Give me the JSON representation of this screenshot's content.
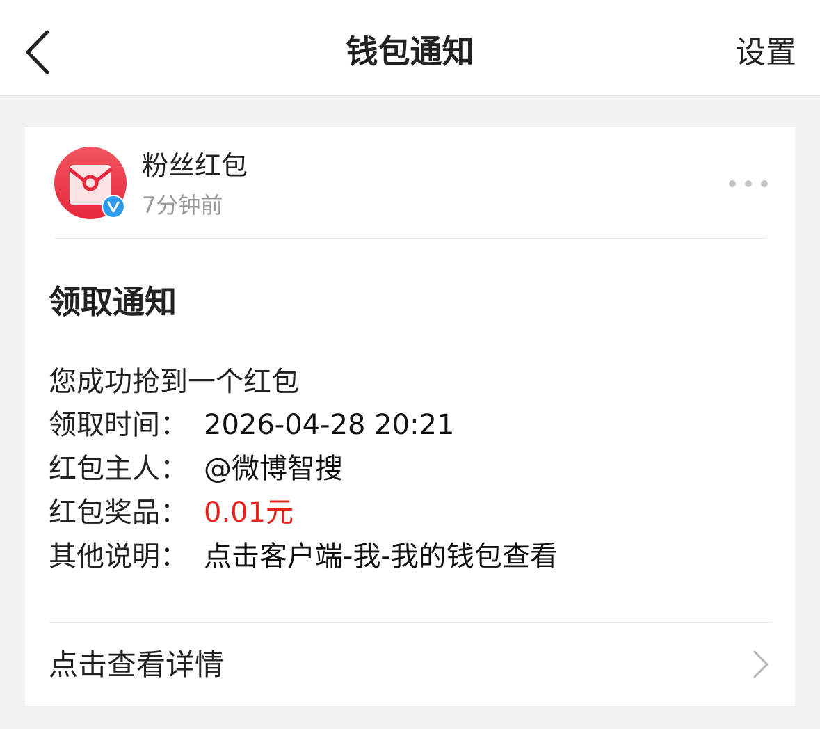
{
  "nav": {
    "title": "钱包通知",
    "settings_label": "设置",
    "back_icon": "chevron-left-icon"
  },
  "message": {
    "sender_name": "粉丝红包",
    "time_ago": "7分钟前",
    "avatar_icon": "red-envelope-icon",
    "verified_icon": "verified-v-icon",
    "more_icon": "more-dots-icon",
    "title": "领取通知",
    "summary": "您成功抢到一个红包",
    "fields": [
      {
        "label": "领取时间：",
        "value": "2026-04-28 20:21"
      },
      {
        "label": "红包主人：",
        "value": "@微博智搜"
      },
      {
        "label": "红包奖品：",
        "value": "0.01元"
      },
      {
        "label": "其他说明：",
        "value": "点击客户端-我-我的钱包查看"
      }
    ],
    "detail_link": "点击查看详情",
    "detail_icon": "chevron-right-icon"
  },
  "colors": {
    "prize": "#e5231c",
    "avatar_red": "#ee3b48",
    "verified_blue": "#2e9bee",
    "page_background": "#f2f2f2"
  }
}
